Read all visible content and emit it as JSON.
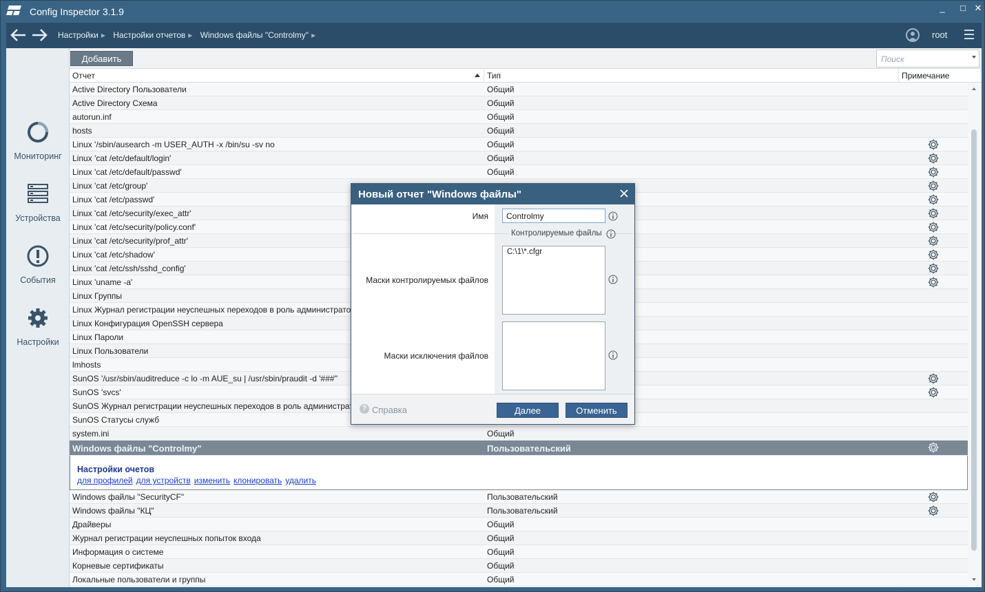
{
  "window": {
    "title": "Config Inspector 3.1.9",
    "minimize": "_",
    "maximize": "□",
    "close": "✕"
  },
  "nav": {
    "crumbs": [
      "Настройки",
      "Настройки отчетов",
      "Windows файлы \"Controlmy\""
    ],
    "user": "root"
  },
  "sidebar": {
    "items": [
      {
        "label": "Мониторинг",
        "icon": "monitoring-icon"
      },
      {
        "label": "Устройства",
        "icon": "devices-icon"
      },
      {
        "label": "События",
        "icon": "events-icon"
      },
      {
        "label": "Настройки",
        "icon": "settings-icon"
      }
    ]
  },
  "toolbar": {
    "add_label": "Добавить",
    "search_placeholder": "Поиск"
  },
  "table": {
    "columns": [
      "Отчет",
      "Тип",
      "Примечание"
    ],
    "rows": [
      {
        "name": "Active Directory Пользователи",
        "type": "Общий",
        "gear": false
      },
      {
        "name": "Active Directory Схема",
        "type": "Общий",
        "gear": false
      },
      {
        "name": "autorun.inf",
        "type": "Общий",
        "gear": false
      },
      {
        "name": "hosts",
        "type": "Общий",
        "gear": false
      },
      {
        "name": "Linux '/sbin/ausearch -m USER_AUTH -x /bin/su -sv no",
        "type": "Общий",
        "gear": true
      },
      {
        "name": "Linux 'cat /etc/default/login'",
        "type": "Общий",
        "gear": true
      },
      {
        "name": "Linux 'cat /etc/default/passwd'",
        "type": "Общий",
        "gear": true
      },
      {
        "name": "Linux 'cat /etc/group'",
        "type": "",
        "gear": true
      },
      {
        "name": "Linux 'cat /etc/passwd'",
        "type": "",
        "gear": true
      },
      {
        "name": "Linux 'cat /etc/security/exec_attr'",
        "type": "",
        "gear": true
      },
      {
        "name": "Linux 'cat /etc/security/policy.conf'",
        "type": "",
        "gear": true
      },
      {
        "name": "Linux 'cat /etc/security/prof_attr'",
        "type": "",
        "gear": true
      },
      {
        "name": "Linux 'cat /etc/shadow'",
        "type": "",
        "gear": true
      },
      {
        "name": "Linux 'cat /etc/ssh/sshd_config'",
        "type": "",
        "gear": true
      },
      {
        "name": "Linux 'uname -a'",
        "type": "",
        "gear": true
      },
      {
        "name": "Linux Группы",
        "type": "",
        "gear": false
      },
      {
        "name": "Linux Журнал регистрации неуспешных переходов в роль администратора",
        "type": "",
        "gear": false
      },
      {
        "name": "Linux Конфигурация OpenSSH сервера",
        "type": "",
        "gear": false
      },
      {
        "name": "Linux Пароли",
        "type": "",
        "gear": false
      },
      {
        "name": "Linux Пользователи",
        "type": "",
        "gear": false
      },
      {
        "name": "lmhosts",
        "type": "",
        "gear": false
      },
      {
        "name": "SunOS '/usr/sbin/auditreduce -c lo -m AUE_su | /usr/sbin/praudit -d '###''",
        "type": "",
        "gear": true
      },
      {
        "name": "SunOS 'svcs'",
        "type": "",
        "gear": true
      },
      {
        "name": "SunOS Журнал регистрации неуспешных переходов в роль администратора",
        "type": "",
        "gear": false
      },
      {
        "name": "SunOS Статусы служб",
        "type": "",
        "gear": false
      },
      {
        "name": "system.ini",
        "type": "Общий",
        "gear": false
      }
    ],
    "selected": {
      "name": "Windows файлы \"Controlmy\"",
      "type": "Пользовательский"
    },
    "detail": {
      "title": "Настройки очетов",
      "links": [
        "для профилей",
        "для устройств",
        "изменить",
        "клонировать",
        "удалить"
      ]
    },
    "rows_after": [
      {
        "name": "Windows файлы \"SecurityCF\"",
        "type": "Пользовательский",
        "gear": true
      },
      {
        "name": "Windows файлы \"КЦ\"",
        "type": "Пользовательский",
        "gear": true
      },
      {
        "name": "Драйверы",
        "type": "Общий",
        "gear": false
      },
      {
        "name": "Журнал регистрации неуспешных попыток входа",
        "type": "Общий",
        "gear": false
      },
      {
        "name": "Информация о системе",
        "type": "Общий",
        "gear": false
      },
      {
        "name": "Корневые сертификаты",
        "type": "Общий",
        "gear": false
      },
      {
        "name": "Локальные пользователи и группы",
        "type": "Общий",
        "gear": false
      }
    ]
  },
  "dialog": {
    "title": "Новый отчет \"Windows файлы\"",
    "name_label": "Имя",
    "name_value": "Controlmy",
    "section_label": "Контролируемые файлы",
    "masks_label": "Маски контролируемых файлов",
    "masks_value": "C:\\1\\*.cfgr",
    "excl_label": "Маски исключения файлов",
    "excl_value": "",
    "help_label": "Справка",
    "next_label": "Далее",
    "cancel_label": "Отменить"
  }
}
